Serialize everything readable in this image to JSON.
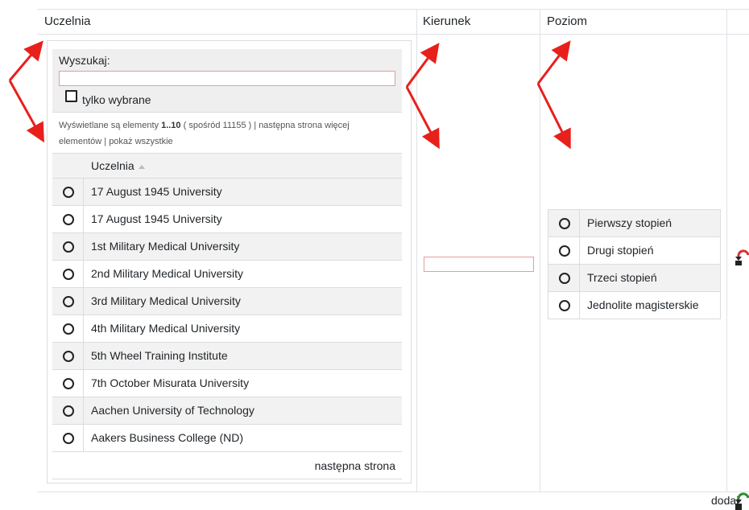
{
  "columns": {
    "uczelnia": "Uczelnia",
    "kierunek": "Kierunek",
    "poziom": "Poziom"
  },
  "search": {
    "label": "Wyszukaj:",
    "value": "",
    "only_selected_label": "tylko wybrane"
  },
  "info": {
    "prefix": "Wyświetlane są elementy",
    "range": "1..10",
    "total": "( spośród 11155 )",
    "sep1": "|",
    "next_more": "następna strona więcej",
    "next_more_cont": "elementów",
    "sep2": "|",
    "show_all": "pokaż wszystkie"
  },
  "table": {
    "header": "Uczelnia",
    "rows": [
      "17 August 1945 University",
      "17 August 1945 University",
      "1st Military Medical University",
      "2nd Military Medical University",
      "3rd Military Medical University",
      "4th Military Medical University",
      "5th Wheel Training Institute",
      "7th October Misurata University",
      "Aachen University of Technology",
      "Aakers Business College (ND)"
    ],
    "next_page": "następna strona"
  },
  "kierunek": {
    "value": ""
  },
  "levels": [
    "Pierwszy stopień",
    "Drugi stopień",
    "Trzeci stopień",
    "Jednolite magisterskie"
  ],
  "add_label": "dodaj",
  "colors": {
    "annotation_arrow": "#e8201c",
    "undo_icon": "#d63232",
    "add_icon": "#2e8b2e",
    "input_border": "#e39e9e"
  }
}
